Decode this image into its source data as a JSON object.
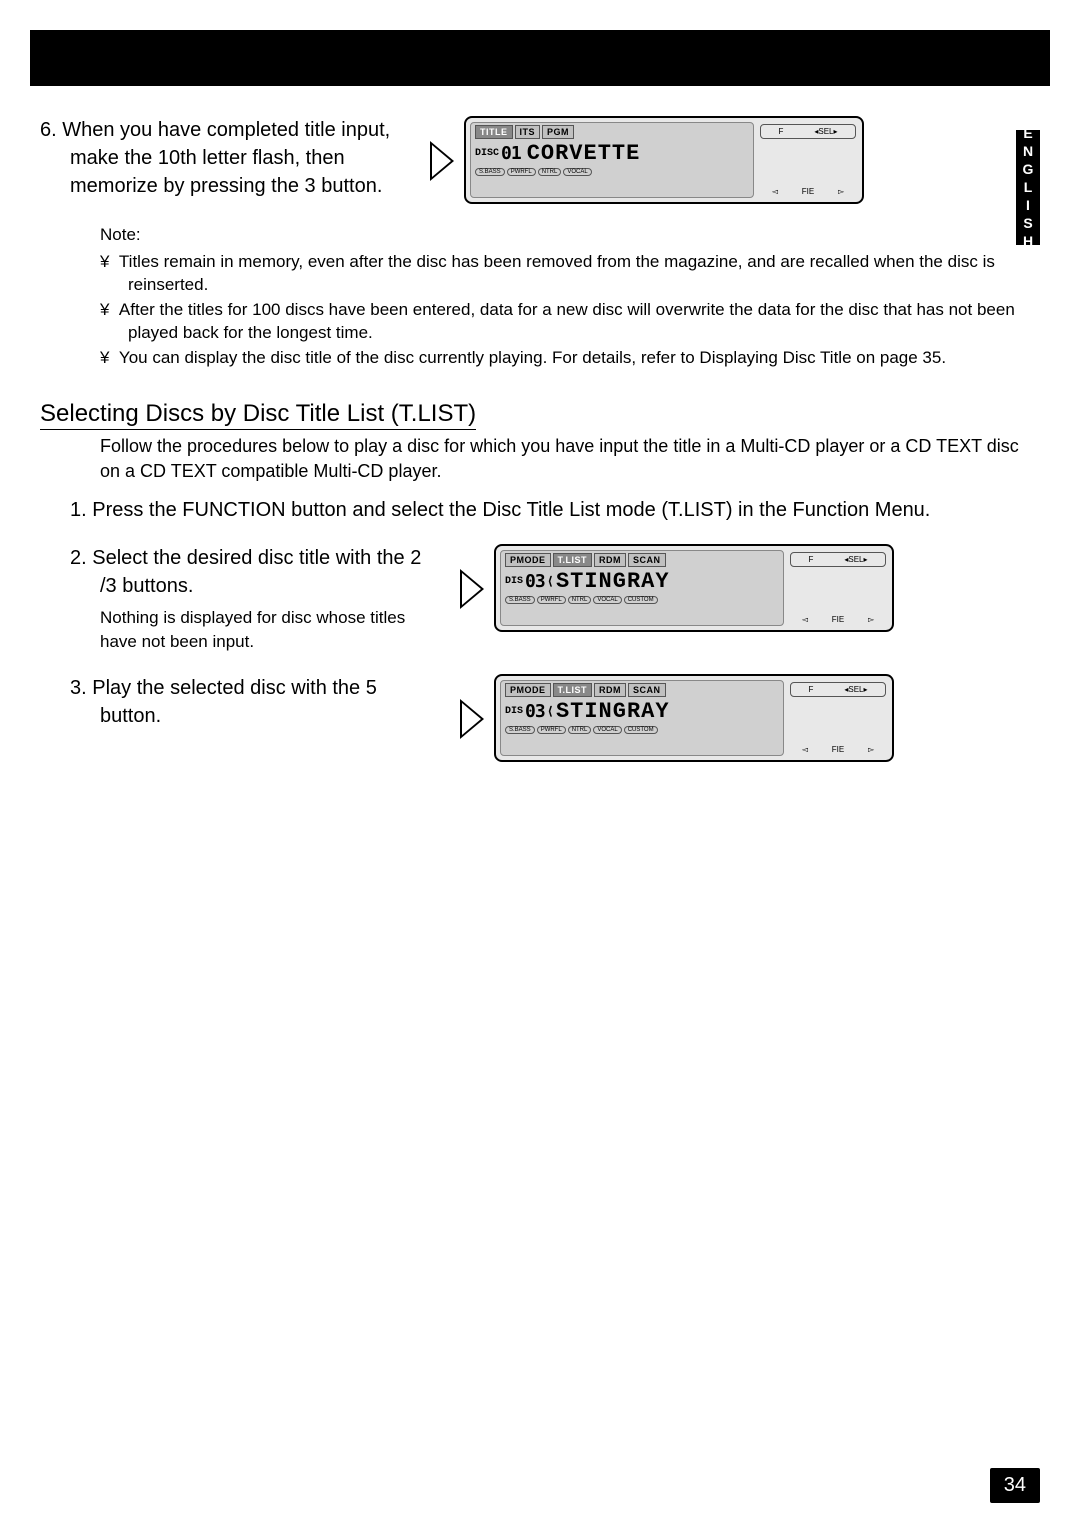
{
  "side_tab": "ENGLISH",
  "step6": {
    "num": "6.",
    "text": "When you have completed title input, make the 10th letter flash, then memorize by pressing the 3  button.",
    "display": {
      "tabs": [
        "TITLE",
        "ITS",
        "PGM"
      ],
      "disc_label": "DISC",
      "disc_num": "01",
      "title": "CORVETTE",
      "bottom": [
        "S.BASS",
        "PWRFL",
        "NTRL",
        "VOCAL"
      ],
      "side_top": "SEL",
      "side_f": "F",
      "side_fie": "FIE"
    }
  },
  "note": {
    "header": "Note:",
    "bullet": "¥",
    "items": [
      "Titles remain in memory, even after the disc has been removed from the magazine, and are recalled when the disc is reinserted.",
      "After the titles for 100 discs have been entered, data for a new disc will overwrite the data for the disc that has not been played back for the longest time.",
      "You can display the disc title of the disc currently playing. For details, refer to  Displaying Disc Title  on page 35."
    ]
  },
  "section": {
    "heading": "Selecting Discs by Disc Title List (T.LIST)",
    "intro": "Follow the procedures below to play a disc for which you have input the title in a Multi-CD player or a CD TEXT disc on a CD TEXT compatible Multi-CD player."
  },
  "step1": {
    "num": "1.",
    "text": "Press the FUNCTION button and select the Disc Title List mode (T.LIST) in the Function Menu."
  },
  "step2": {
    "num": "2.",
    "text": "Select the desired disc title with the 2 /3  buttons.",
    "sub": "Nothing is displayed for disc whose titles have not been input.",
    "display": {
      "tabs": [
        "PMODE",
        "T.LIST",
        "RDM",
        "SCAN"
      ],
      "disc_label": "DIS",
      "disc_num": "03",
      "title": "STINGRAY",
      "bottom": [
        "S.BASS",
        "PWRFL",
        "NTRL",
        "VOCAL",
        "CUSTOM"
      ],
      "side_top": "SEL",
      "side_f": "F",
      "side_fie": "FIE"
    }
  },
  "step3": {
    "num": "3.",
    "text": "Play the selected disc with the 5  button.",
    "display": {
      "tabs": [
        "PMODE",
        "T.LIST",
        "RDM",
        "SCAN"
      ],
      "disc_label": "DIS",
      "disc_num": "03",
      "title": "STINGRAY",
      "bottom": [
        "S.BASS",
        "PWRFL",
        "NTRL",
        "VOCAL",
        "CUSTOM"
      ],
      "side_top": "SEL",
      "side_f": "F",
      "side_fie": "FIE"
    }
  },
  "page_number": "34"
}
